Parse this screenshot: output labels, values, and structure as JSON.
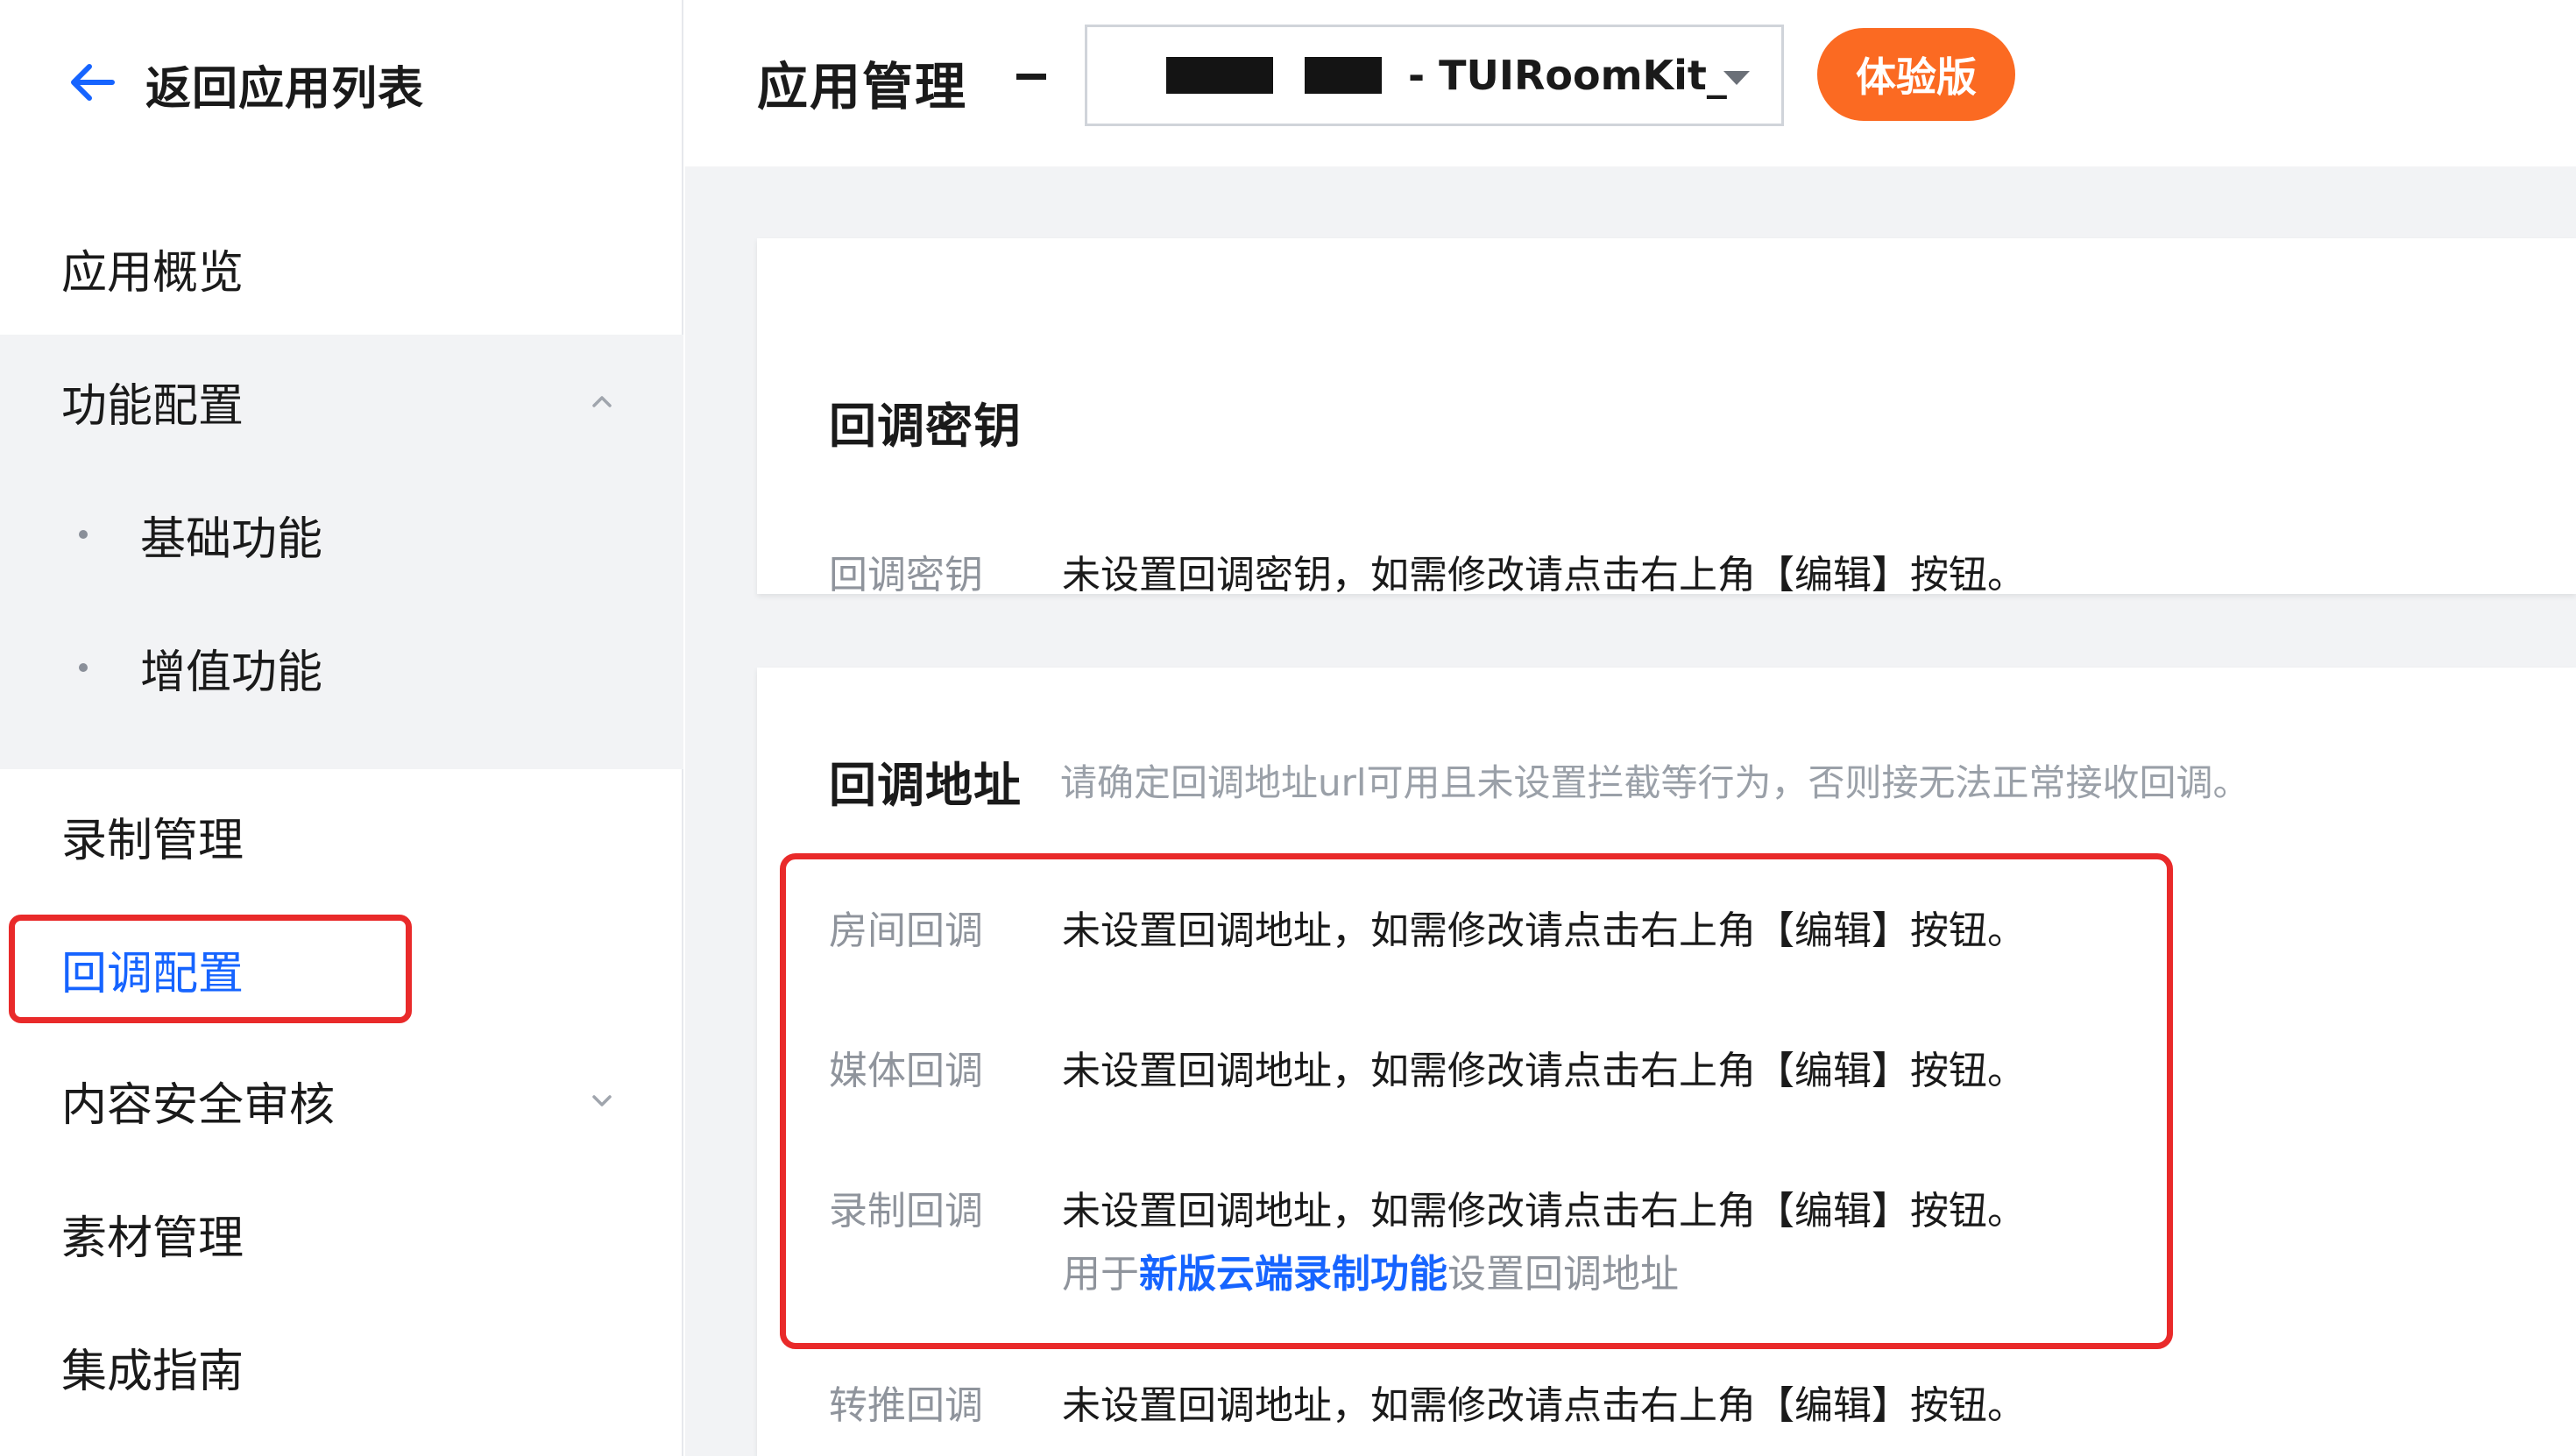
{
  "sidebar": {
    "back_label": "返回应用列表",
    "items": [
      {
        "label": "应用概览"
      },
      {
        "label": "功能配置"
      },
      {
        "label": "基础功能"
      },
      {
        "label": "增值功能"
      },
      {
        "label": "录制管理"
      },
      {
        "label": "回调配置"
      },
      {
        "label": "内容安全审核"
      },
      {
        "label": "素材管理"
      },
      {
        "label": "集成指南"
      }
    ],
    "active_item": "回调配置"
  },
  "header": {
    "title": "应用管理",
    "app_select_value": "- TUIRoomKit_",
    "badge": "体验版"
  },
  "callback_key_card": {
    "title": "回调密钥",
    "label": "回调密钥",
    "value": "未设置回调密钥，如需修改请点击右上角【编辑】按钮。"
  },
  "callback_url_card": {
    "title": "回调地址",
    "hint": "请确定回调地址url可用且未设置拦截等行为，否则接无法正常接收回调。",
    "rows": [
      {
        "label": "房间回调",
        "value": "未设置回调地址，如需修改请点击右上角【编辑】按钮。"
      },
      {
        "label": "媒体回调",
        "value": "未设置回调地址，如需修改请点击右上角【编辑】按钮。"
      },
      {
        "label": "录制回调",
        "value": "未设置回调地址，如需修改请点击右上角【编辑】按钮。",
        "sub_prefix": "用于",
        "sub_link": "新版云端录制功能",
        "sub_suffix": "设置回调地址"
      },
      {
        "label": "转推回调",
        "value": "未设置回调地址，如需修改请点击右上角【编辑】按钮。"
      }
    ]
  },
  "colors": {
    "accent": "#1664ff",
    "badge": "#fb6a22",
    "highlight": "#e92a2a"
  }
}
